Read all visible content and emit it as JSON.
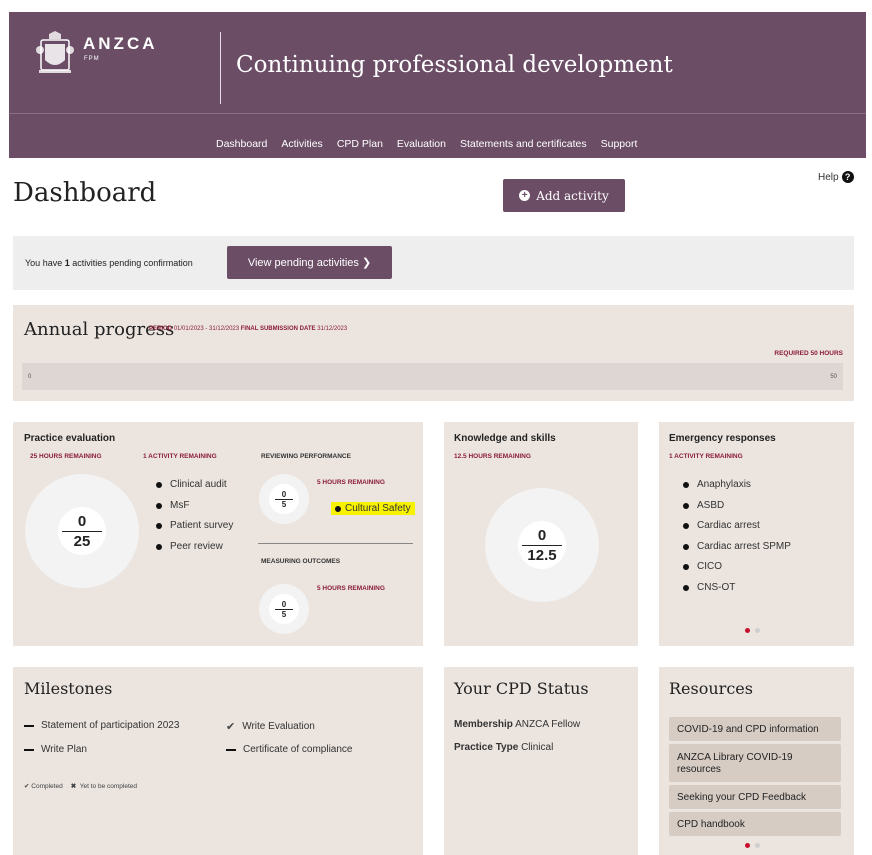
{
  "header": {
    "brand": "ANZCA",
    "brand_sub": "FPM",
    "title": "Continuing professional development",
    "nav": [
      "Dashboard",
      "Activities",
      "CPD Plan",
      "Evaluation",
      "Statements and certificates",
      "Support"
    ]
  },
  "page": {
    "title": "Dashboard",
    "add_activity": "Add activity",
    "help": "Help"
  },
  "pending": {
    "prefix": "You have ",
    "count": "1",
    "suffix": " activities pending confirmation",
    "button": "View pending activities ❯"
  },
  "annual": {
    "title": "Annual progress",
    "period_label": "PERIOD",
    "period": "01/01/2023 - 31/12/2023",
    "final_label": "FINAL SUBMISSION DATE",
    "final": "31/12/2023",
    "required": "REQUIRED 50 HOURS",
    "min": "0",
    "max": "50",
    "progress_fraction": 0
  },
  "practice": {
    "title": "Practice evaluation",
    "hours_remaining": "25 HOURS REMAINING",
    "activity_remaining": "1 ACTIVITY REMAINING",
    "done": "0",
    "total": "25",
    "items": [
      "Clinical audit",
      "MsF",
      "Patient survey",
      "Peer review"
    ],
    "reviewing": {
      "title": "REVIEWING PERFORMANCE",
      "hours": "5 HOURS REMAINING",
      "done": "0",
      "total": "5",
      "item": "Cultural Safety"
    },
    "measuring": {
      "title": "MEASURING OUTCOMES",
      "hours": "5 HOURS REMAINING",
      "done": "0",
      "total": "5"
    }
  },
  "knowledge": {
    "title": "Knowledge and skills",
    "hours_remaining": "12.5 HOURS REMAINING",
    "done": "0",
    "total": "12.5"
  },
  "emergency": {
    "title": "Emergency responses",
    "activity_remaining": "1 ACTIVITY REMAINING",
    "items": [
      "Anaphylaxis",
      "ASBD",
      "Cardiac arrest",
      "Cardiac arrest SPMP",
      "CICO",
      "CNS-OT"
    ]
  },
  "milestones": {
    "title": "Milestones",
    "items": [
      {
        "label": "Statement of participation 2023",
        "status": "pending"
      },
      {
        "label": "Write Evaluation",
        "status": "completed"
      },
      {
        "label": "Write Plan",
        "status": "pending"
      },
      {
        "label": "Certificate of compliance",
        "status": "pending"
      }
    ],
    "legend_completed": "Completed",
    "legend_pending": "Yet to be completed"
  },
  "status": {
    "title": "Your CPD Status",
    "membership_label": "Membership",
    "membership": "ANZCA Fellow",
    "practice_label": "Practice Type",
    "practice": "Clinical"
  },
  "resources": {
    "title": "Resources",
    "items": [
      "COVID-19 and CPD information",
      "ANZCA Library COVID-19 resources",
      "Seeking your CPD Feedback",
      "CPD handbook"
    ]
  },
  "colors": {
    "brand": "#6b4d66",
    "accent": "#8b1c3b",
    "card_bg": "#ebe4df",
    "highlight": "#f7f200"
  }
}
